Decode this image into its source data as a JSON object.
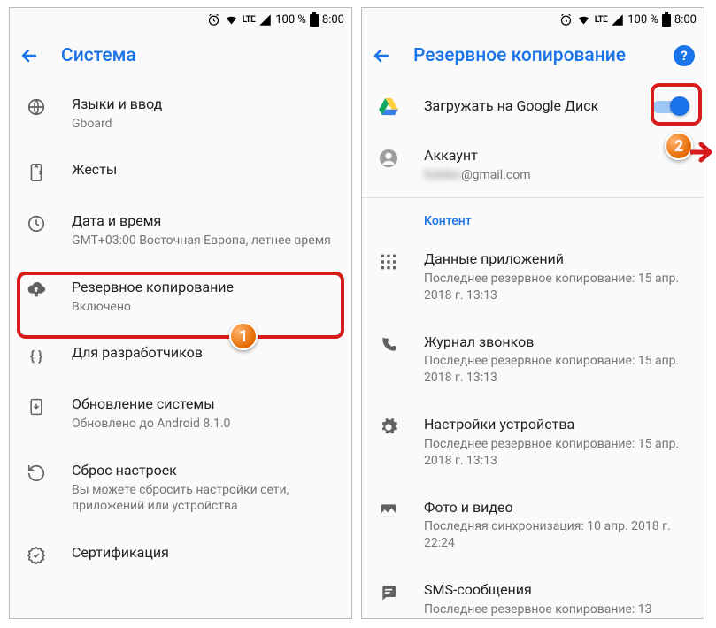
{
  "statusbar": {
    "battery": "100 %",
    "time": "8:00",
    "network": "LTE"
  },
  "left": {
    "title": "Система",
    "items": [
      {
        "title": "Языки и ввод",
        "sub": "Gboard"
      },
      {
        "title": "Жесты"
      },
      {
        "title": "Дата и время",
        "sub": "GMT+03:00 Восточная Европа, летнее время"
      },
      {
        "title": "Резервное копирование",
        "sub": "Включено"
      },
      {
        "title": "Для разработчиков"
      },
      {
        "title": "Обновление системы",
        "sub": "Обновлено до Android 8.1.0"
      },
      {
        "title": "Сброс настроек",
        "sub": "Вы можете сбросить настройки сети, приложений или устройства"
      },
      {
        "title": "Сертификация"
      }
    ]
  },
  "right": {
    "title": "Резервное копирование",
    "upload": "Загружать на Google Диск",
    "account_label": "Аккаунт",
    "account_value_hidden": "hidden",
    "account_suffix": "@gmail.com",
    "section": "Контент",
    "content": [
      {
        "title": "Данные приложений",
        "sub": "Последнее резервное копирование: 15 апр. 2018 г. 13:13"
      },
      {
        "title": "Журнал звонков",
        "sub": "Последнее резервное копирование: 15 апр. 2018 г. 13:13"
      },
      {
        "title": "Настройки устройства",
        "sub": "Последнее резервное копирование: 15 апр. 2018 г. 13:13"
      },
      {
        "title": "Фото и видео",
        "sub": "Последняя синхронизация: 10 апр. 2018 г. 22:24"
      },
      {
        "title": "SMS-сообщения",
        "sub": "Последнее резервное копирование: 13"
      }
    ]
  },
  "callouts": {
    "one": "1",
    "two": "2"
  }
}
